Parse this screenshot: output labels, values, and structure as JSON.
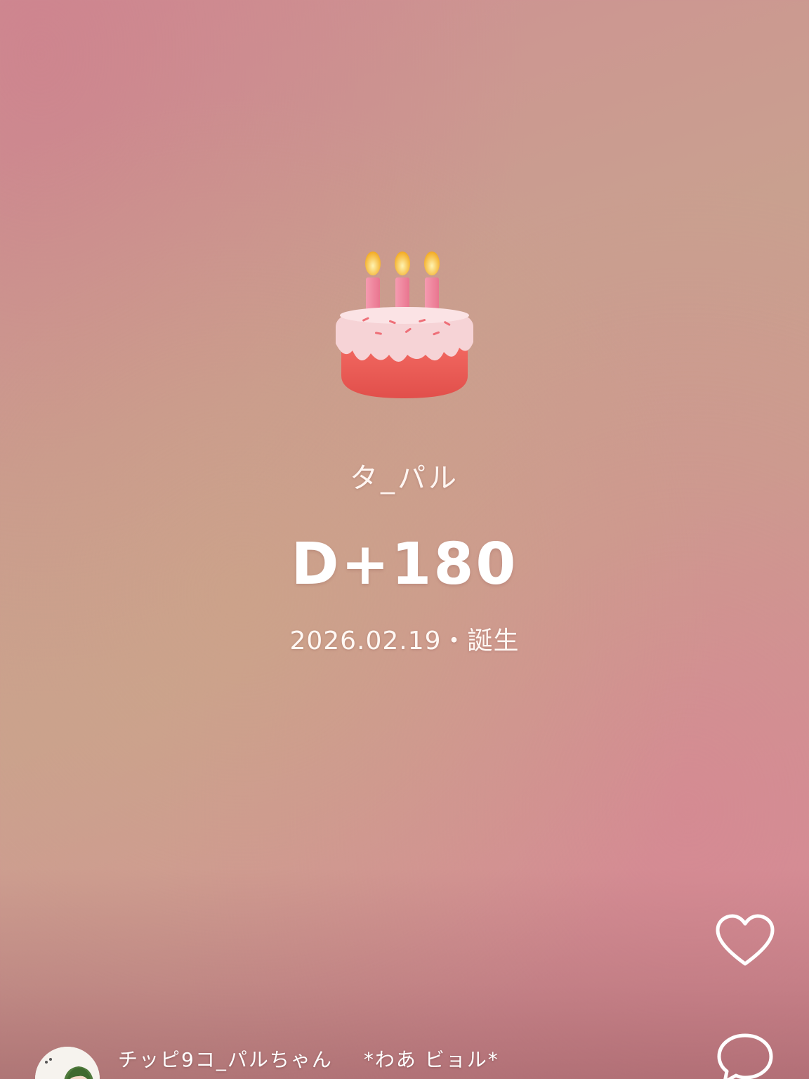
{
  "post": {
    "emoji_icon": "birthday-cake-icon",
    "name": "タ_パル",
    "dday": "D+180",
    "date_line": "2026.02.19・誕生"
  },
  "actions": {
    "like_icon": "heart-outline-icon",
    "comment_icon": "comment-bubble-icon"
  },
  "author": {
    "name": "チッピ9コ_パルちゃん",
    "caption": "*わあ ビョル*"
  },
  "colors": {
    "text": "#ffffff",
    "cake_base": "#ee5a55",
    "frosting": "#f7d6d8",
    "candle": "#f28aa0",
    "flame": "#f6b731"
  }
}
